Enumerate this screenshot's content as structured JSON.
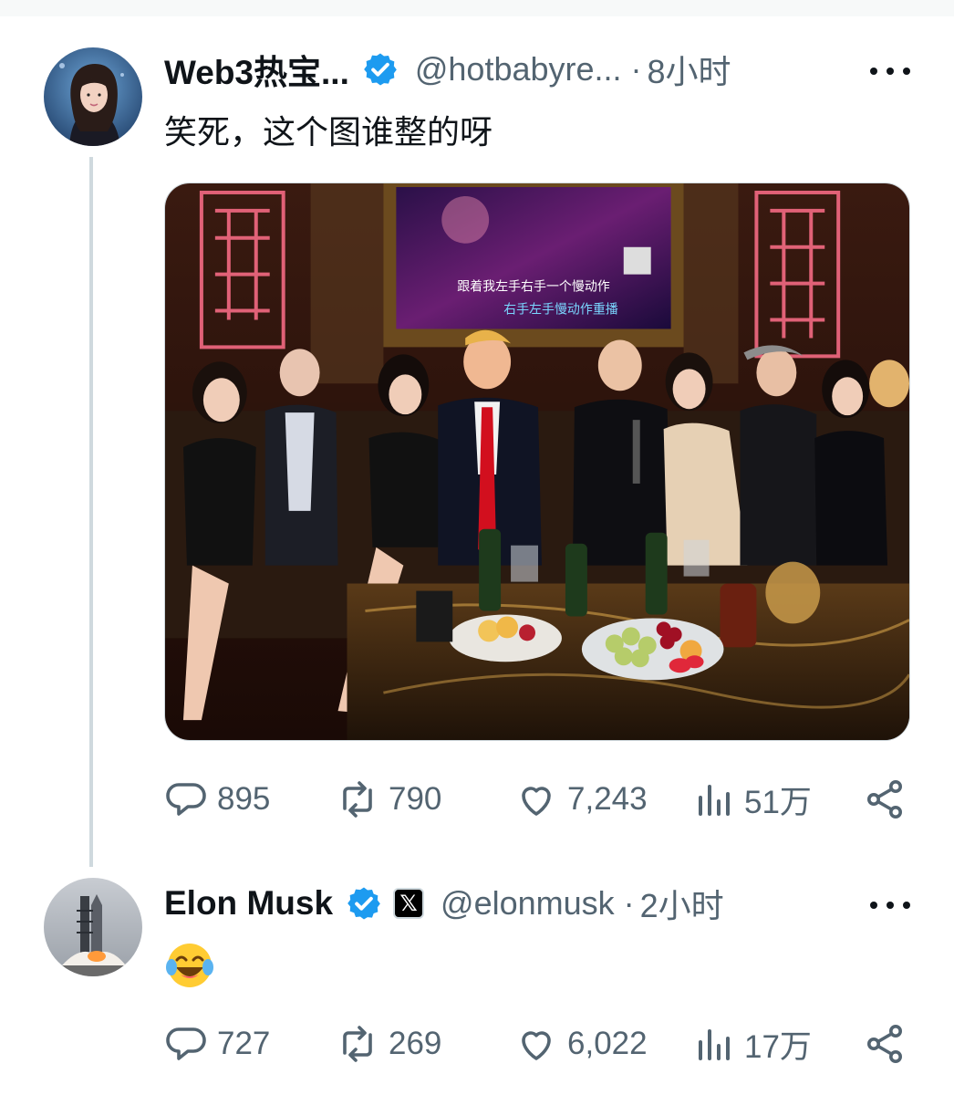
{
  "tweets": [
    {
      "author": {
        "name": "Web3热宝...",
        "handle": "@hotbabyre...",
        "time": "8小时",
        "avatar": "woman-portrait-avatar"
      },
      "text": "笑死，这个图谁整的呀",
      "media": {
        "subtitle_line_1": "跟着我左手右手一个慢动作",
        "subtitle_line_2": "右手左手慢动作重播"
      },
      "stats": {
        "replies": "895",
        "reposts": "790",
        "likes": "7,243",
        "views": "51万"
      }
    },
    {
      "author": {
        "name": "Elon Musk",
        "handle": "@elonmusk",
        "time": "2小时",
        "badge": "𝕏",
        "avatar": "rocket-launch-avatar"
      },
      "text_emoji": "face-with-tears-of-joy",
      "stats": {
        "replies": "727",
        "reposts": "269",
        "likes": "6,022",
        "views": "17万"
      }
    }
  ],
  "colors": {
    "verified_blue": "#1d9bf0",
    "muted_text": "#536471",
    "thread_line": "#cfd9de"
  },
  "icons": {
    "reply": "speech-bubble-icon",
    "repost": "repost-arrows-icon",
    "like": "heart-icon",
    "views": "bar-chart-icon",
    "share": "share-nodes-icon",
    "more": "more-dots-icon",
    "verified": "verified-badge-icon"
  }
}
